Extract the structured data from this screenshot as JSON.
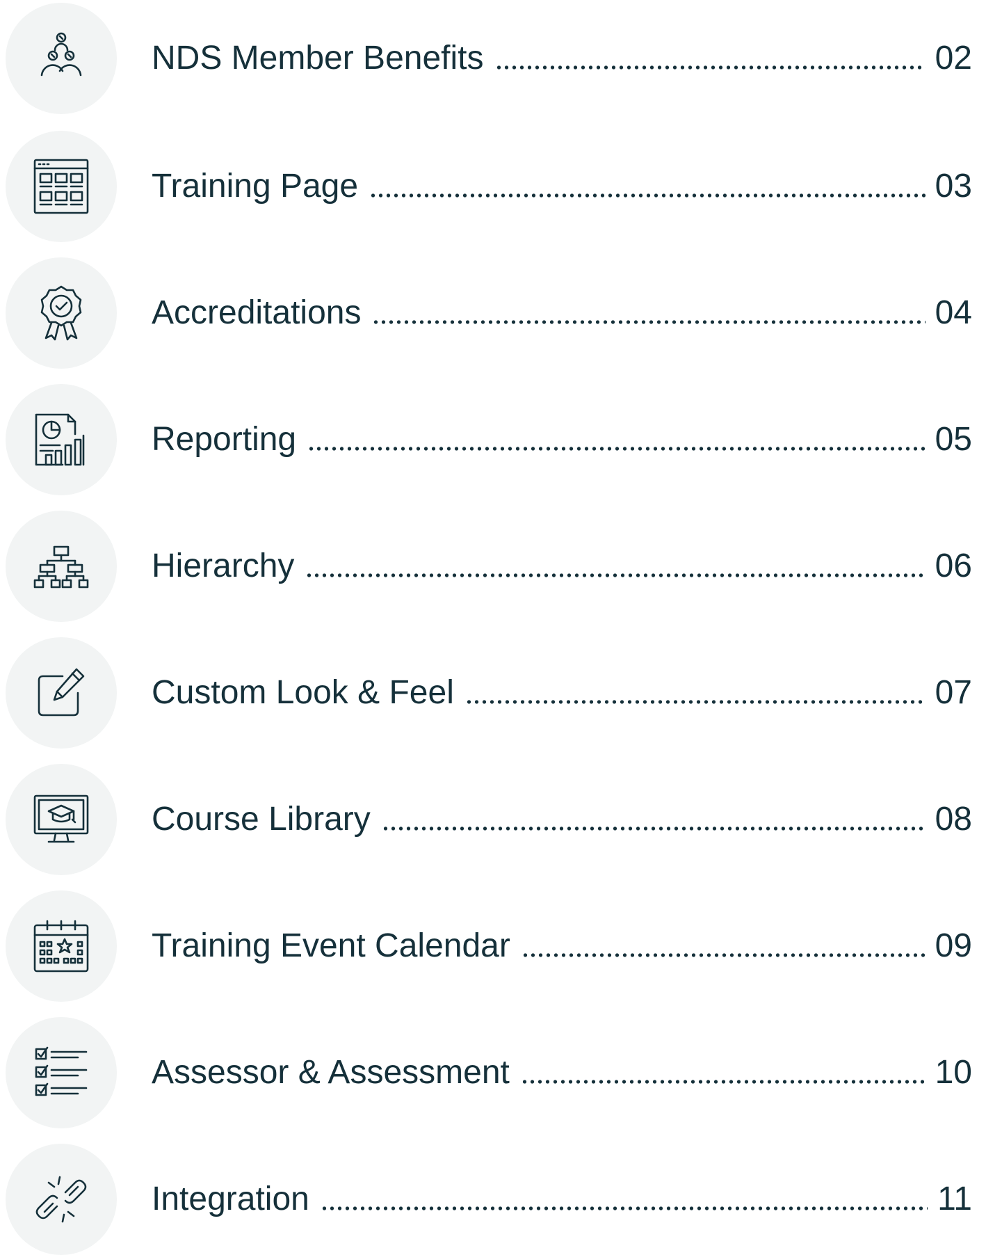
{
  "toc": {
    "entries": [
      {
        "title": "NDS Member Benefits",
        "page": "02",
        "icon": "people-network-icon"
      },
      {
        "title": "Training Page",
        "page": "03",
        "icon": "browser-grid-icon"
      },
      {
        "title": "Accreditations",
        "page": "04",
        "icon": "award-badge-icon"
      },
      {
        "title": "Reporting",
        "page": "05",
        "icon": "report-document-icon"
      },
      {
        "title": "Hierarchy",
        "page": "06",
        "icon": "org-chart-icon"
      },
      {
        "title": "Custom Look & Feel",
        "page": "07",
        "icon": "edit-pencil-icon"
      },
      {
        "title": "Course Library",
        "page": "08",
        "icon": "monitor-graduation-icon"
      },
      {
        "title": "Training Event Calendar",
        "page": "09",
        "icon": "calendar-star-icon"
      },
      {
        "title": "Assessor & Assessment",
        "page": "10",
        "icon": "checklist-icon"
      },
      {
        "title": "Integration",
        "page": "11",
        "icon": "broken-link-icon"
      }
    ]
  },
  "colors": {
    "text": "#15303a",
    "icon_background": "#f2f4f4",
    "page_background": "#ffffff"
  }
}
